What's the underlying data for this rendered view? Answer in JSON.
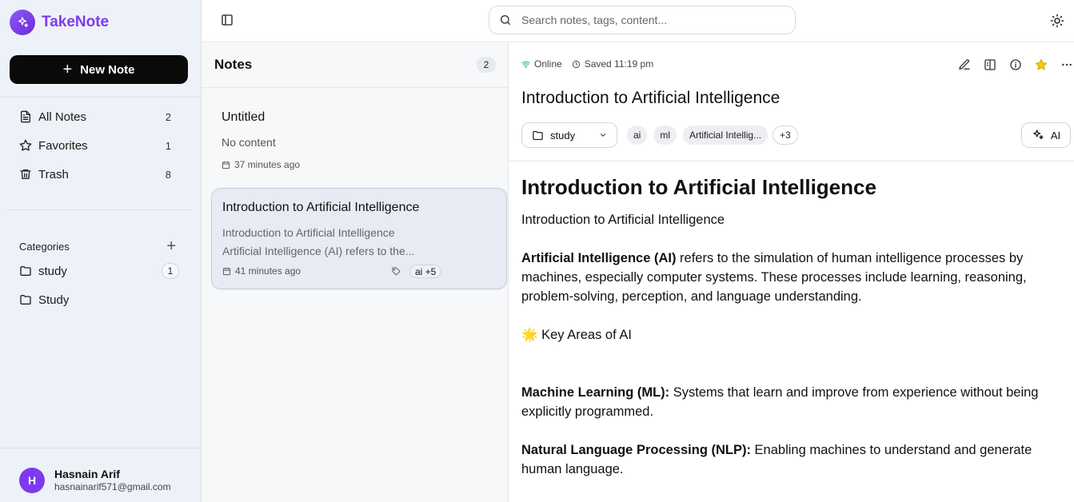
{
  "brand": {
    "name": "TakeNote"
  },
  "sidebar": {
    "new_note_label": "New Note",
    "nav": [
      {
        "label": "All Notes",
        "count": "2",
        "icon": "file-text-icon"
      },
      {
        "label": "Favorites",
        "count": "1",
        "icon": "star-icon"
      },
      {
        "label": "Trash",
        "count": "8",
        "icon": "trash-icon"
      }
    ],
    "categories_title": "Categories",
    "categories": [
      {
        "label": "study",
        "count": "1"
      },
      {
        "label": "Study",
        "count": ""
      }
    ]
  },
  "user": {
    "initial": "H",
    "name": "Hasnain Arif",
    "email": "hasnainarif571@gmail.com"
  },
  "search": {
    "placeholder": "Search notes, tags, content..."
  },
  "notes_panel": {
    "title": "Notes",
    "count": "2",
    "notes": [
      {
        "title": "Untitled",
        "preview": "No content",
        "time": "37 minutes ago",
        "tags": ""
      },
      {
        "title": "Introduction to Artificial Intelligence",
        "preview_line1": "Introduction to Artificial Intelligence",
        "preview_line2": "Artificial Intelligence (AI) refers to the...",
        "time": "41 minutes ago",
        "tags": "ai +5"
      }
    ]
  },
  "editor": {
    "status_online": "Online",
    "status_saved": "Saved 11:19 pm",
    "title": "Introduction to Artificial Intelligence",
    "category": "study",
    "tags": [
      "ai",
      "ml",
      "Artificial Intellig..."
    ],
    "tags_more": "+3",
    "ai_label": "AI",
    "content": {
      "heading": "Introduction to Artificial Intelligence",
      "intro": "Introduction to Artificial Intelligence",
      "p1_bold": "Artificial Intelligence (AI)",
      "p1_text": " refers to the simulation of human intelligence processes by machines, especially computer systems. These processes include learning, reasoning, problem-solving, perception, and language understanding.",
      "key_areas": "🌟 Key Areas of AI",
      "ml_bold": "Machine Learning (ML):",
      "ml_text": " Systems that learn and improve from experience without being explicitly programmed.",
      "nlp_bold": "Natural Language Processing (NLP):",
      "nlp_text": " Enabling machines to understand and generate human language."
    }
  },
  "colors": {
    "brand": "#7c3aed",
    "online": "#22c55e",
    "favorite": "#f5c518"
  }
}
